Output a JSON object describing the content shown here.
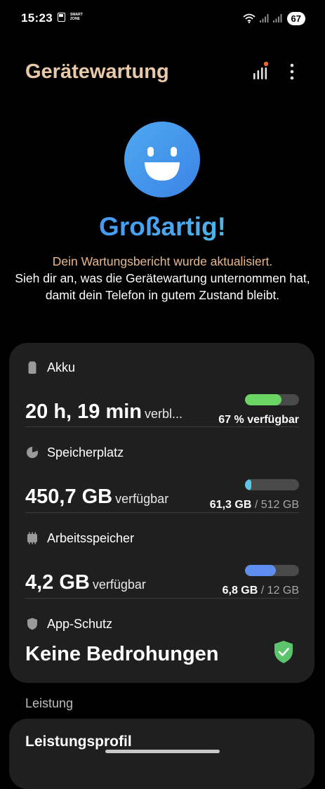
{
  "status_bar": {
    "time": "15:23",
    "smart_zone_line1": "SMART",
    "smart_zone_line2": "ZONE",
    "battery": "67"
  },
  "header": {
    "title": "Gerätewartung"
  },
  "hero": {
    "title": "Großartig!",
    "subtitle": "Dein Wartungsbericht wurde aktualisiert.",
    "body": "Sieh dir an, was die Gerätewartung unternommen hat, damit dein Telefon in gutem Zustand bleibt."
  },
  "items": {
    "akku": {
      "title": "Akku",
      "value": "20 h, 19 min",
      "unit": "verbl...",
      "stat": "67 % verfügbar",
      "fill": 0.67,
      "color": "#6ad563"
    },
    "speicher": {
      "title": "Speicherplatz",
      "value": "450,7 GB",
      "unit": "verfügbar",
      "used": "61,3 GB",
      "total": "/ 512 GB",
      "fill": 0.12,
      "color": "#5cc4e8"
    },
    "arbeitsspeicher": {
      "title": "Arbeitsspeicher",
      "value": "4,2 GB",
      "unit": "verfügbar",
      "used": "6,8 GB",
      "total": "/ 12 GB",
      "fill": 0.57,
      "color": "#5d8def"
    },
    "appschutz": {
      "title": "App-Schutz",
      "value": "Keine Bedrohungen",
      "check_color": "#5cc46a"
    }
  },
  "section": {
    "label": "Leistung",
    "card_title": "Leistungsprofil"
  },
  "colors": {
    "title": "#e8c9a8",
    "accent": "#e9b98d",
    "card": "#1f1f1f"
  }
}
